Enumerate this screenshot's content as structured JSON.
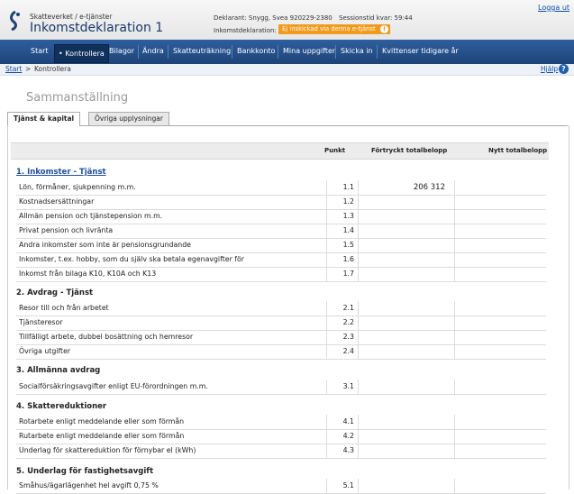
{
  "header": {
    "brand_small": "Skatteverket / e-tjänster",
    "app_title": "Inkomstdeklaration 1",
    "declarant": "Deklarant: Snygg, Svea 920229-2380",
    "session": "Sessionstid kvar: 59:44",
    "decl_status_label": "Inkomstdeklaration:",
    "decl_status_badge": "Ej inskickad via denna e-tjänst",
    "logout": "Logga ut"
  },
  "nav": {
    "items": [
      "Start",
      "Kontrollera",
      "Bilagor",
      "Ändra",
      "Skatteuträkning",
      "Bankkonto",
      "Mina uppgifter",
      "Skicka in",
      "Kvittenser tidigare år"
    ],
    "active_index": 1
  },
  "breadcrumb": {
    "start": "Start",
    "separator": ">",
    "current": "Kontrollera",
    "help": "Hjälp"
  },
  "page": {
    "title": "Sammanställning",
    "tabs": [
      "Tjänst & kapital",
      "Övriga upplysningar"
    ]
  },
  "table": {
    "headers": {
      "punkt": "Punkt",
      "fortryckt": "Förtryckt totalbelopp",
      "nytt": "Nytt totalbelopp"
    },
    "sections": [
      {
        "title": "1. Inkomster - Tjänst",
        "rows": [
          {
            "label": "Lön, förmåner, sjukpenning m.m.",
            "punkt": "1.1",
            "fortryckt": "206 312"
          },
          {
            "label": "Kostnadsersättningar",
            "punkt": "1.2",
            "fortryckt": ""
          },
          {
            "label": "Allmän pension och tjänstepension m.m.",
            "punkt": "1.3",
            "fortryckt": ""
          },
          {
            "label": "Privat pension och livränta",
            "punkt": "1.4",
            "fortryckt": ""
          },
          {
            "label": "Andra inkomster som inte är pensionsgrundande",
            "punkt": "1.5",
            "fortryckt": ""
          },
          {
            "label": "Inkomster, t.ex. hobby, som du själv ska betala egenavgifter för",
            "punkt": "1.6",
            "fortryckt": ""
          },
          {
            "label": "Inkomst från bilaga K10, K10A och K13",
            "punkt": "1.7",
            "fortryckt": ""
          }
        ]
      },
      {
        "title": "2. Avdrag - Tjänst",
        "rows": [
          {
            "label": "Resor till och från arbetet",
            "punkt": "2.1",
            "fortryckt": ""
          },
          {
            "label": "Tjänsteresor",
            "punkt": "2.2",
            "fortryckt": ""
          },
          {
            "label": "Tillfälligt arbete, dubbel bosättning och hemresor",
            "punkt": "2.3",
            "fortryckt": ""
          },
          {
            "label": "Övriga utgifter",
            "punkt": "2.4",
            "fortryckt": ""
          }
        ]
      },
      {
        "title": "3. Allmänna avdrag",
        "rows": [
          {
            "label": "Socialförsäkringsavgifter enligt EU-förordningen m.m.",
            "punkt": "3.1",
            "fortryckt": ""
          }
        ]
      },
      {
        "title": "4. Skattereduktioner",
        "rows": [
          {
            "label": "Rotarbete enligt meddelande eller som förmån",
            "punkt": "4.1",
            "fortryckt": ""
          },
          {
            "label": "Rutarbete enligt meddelande eller som förmån",
            "punkt": "4.2",
            "fortryckt": ""
          },
          {
            "label": "Underlag för skattereduktion för förnybar el (kWh)",
            "punkt": "4.3",
            "fortryckt": ""
          }
        ]
      },
      {
        "title": "5. Underlag för fastighetsavgift",
        "rows": [
          {
            "label": "Småhus/ägarlägenhet hel avgift 0,75 %",
            "punkt": "5.1",
            "fortryckt": ""
          }
        ]
      }
    ]
  },
  "colors": {
    "nav_bg": "#1d4378",
    "badge_bg": "#f29a1b",
    "link": "#0b4bb0",
    "section_link": "#1d4fa0"
  }
}
